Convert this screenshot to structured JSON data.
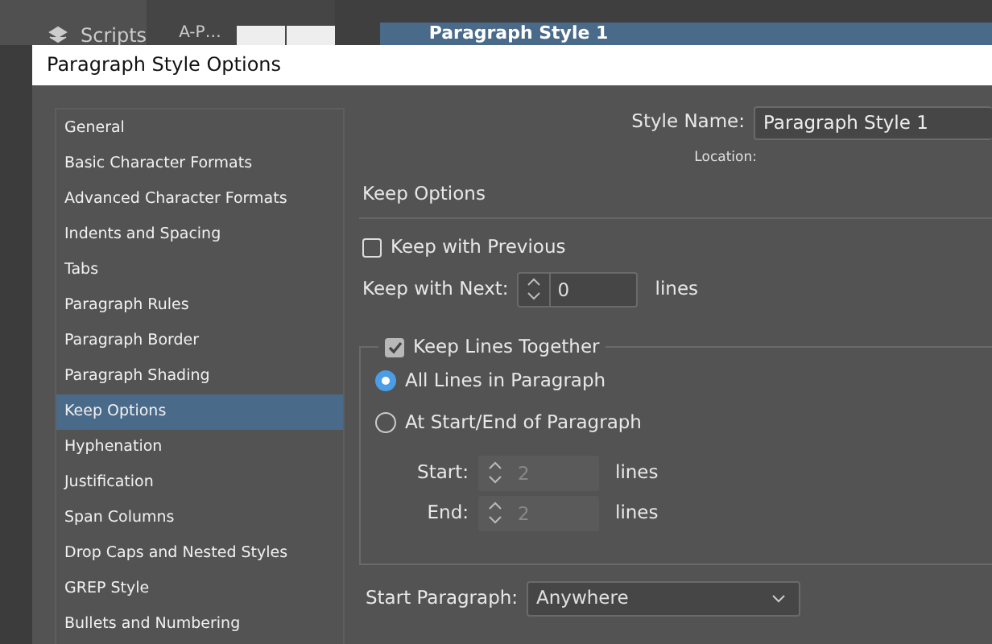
{
  "background_app": {
    "panel_items": [
      {
        "label": "Scripts"
      }
    ],
    "swatch_label": "A-P…",
    "styles_list": [
      {
        "label": "Paragraph Style 1",
        "selected": true
      }
    ]
  },
  "dialog": {
    "title": "Paragraph Style Options",
    "sidebar": {
      "items": [
        {
          "label": "General",
          "selected": false
        },
        {
          "label": "Basic Character Formats",
          "selected": false
        },
        {
          "label": "Advanced Character Formats",
          "selected": false
        },
        {
          "label": "Indents and Spacing",
          "selected": false
        },
        {
          "label": "Tabs",
          "selected": false
        },
        {
          "label": "Paragraph Rules",
          "selected": false
        },
        {
          "label": "Paragraph Border",
          "selected": false
        },
        {
          "label": "Paragraph Shading",
          "selected": false
        },
        {
          "label": "Keep Options",
          "selected": true
        },
        {
          "label": "Hyphenation",
          "selected": false
        },
        {
          "label": "Justification",
          "selected": false
        },
        {
          "label": "Span Columns",
          "selected": false
        },
        {
          "label": "Drop Caps and Nested Styles",
          "selected": false
        },
        {
          "label": "GREP Style",
          "selected": false
        },
        {
          "label": "Bullets and Numbering",
          "selected": false
        }
      ]
    },
    "style_name": {
      "label": "Style Name:",
      "value": "Paragraph Style 1"
    },
    "location_label": "Location:",
    "section_title": "Keep Options",
    "keep_with_previous": {
      "label": "Keep with Previous",
      "checked": false
    },
    "keep_with_next": {
      "label": "Keep with Next:",
      "value": "0",
      "unit": "lines",
      "disabled": false
    },
    "keep_lines_together": {
      "label": "Keep Lines Together",
      "checked": true,
      "options": [
        {
          "label": "All Lines in Paragraph",
          "selected": true
        },
        {
          "label": "At Start/End of Paragraph",
          "selected": false
        }
      ],
      "start": {
        "label": "Start:",
        "value": "2",
        "unit": "lines",
        "disabled": true
      },
      "end": {
        "label": "End:",
        "value": "2",
        "unit": "lines",
        "disabled": true
      }
    },
    "start_paragraph": {
      "label": "Start Paragraph:",
      "value": "Anywhere"
    }
  }
}
